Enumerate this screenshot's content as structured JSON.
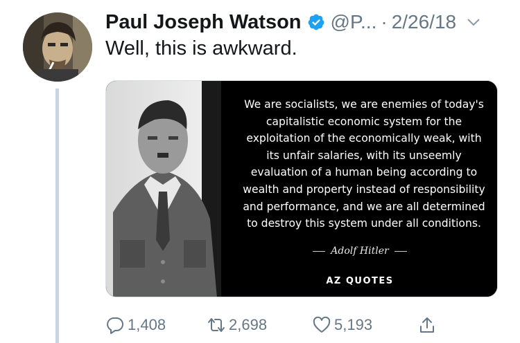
{
  "tweet": {
    "author_name": "Paul Joseph Watson",
    "handle": "@P...",
    "separator": "·",
    "date": "2/26/18",
    "text": "Well, this is awkward."
  },
  "media": {
    "quote_lines": [
      "We are socialists, we are enemies of today's",
      "capitalistic economic system for the",
      "exploitation of the economically weak, with",
      "its unfair salaries, with its unseemly",
      "evaluation of a human being according to",
      "wealth and property instead of responsibility",
      "and performance, and we are all determined",
      "to destroy this system under all conditions."
    ],
    "author_signature": "Adolf Hitler",
    "brand": "AZ QUOTES"
  },
  "actions": {
    "replies": "1,408",
    "retweets": "2,698",
    "likes": "5,193"
  },
  "icons": {
    "verified": "verified-badge-icon",
    "caret": "chevron-down-icon",
    "reply": "reply-icon",
    "retweet": "retweet-icon",
    "like": "heart-icon",
    "share": "share-icon"
  },
  "colors": {
    "verified_blue": "#1da1f2",
    "muted_text": "#657786",
    "thread_line": "#c9d6df"
  }
}
